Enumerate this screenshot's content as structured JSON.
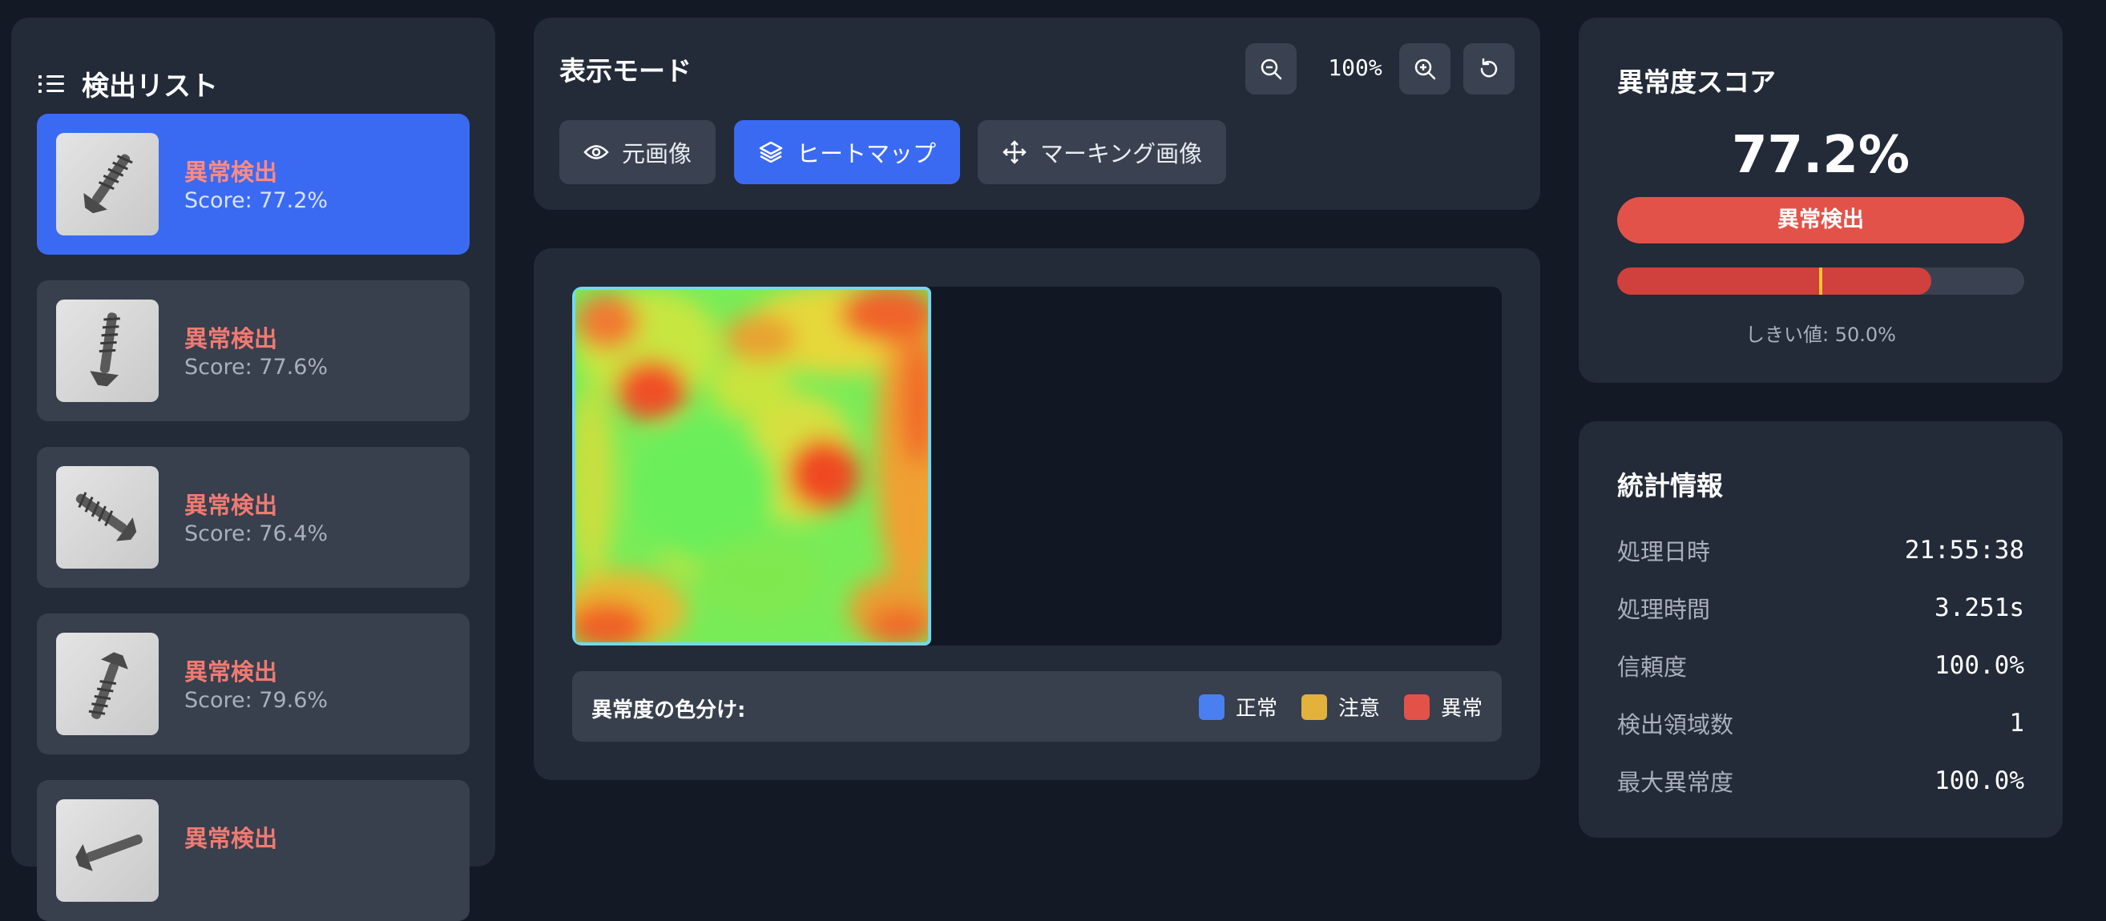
{
  "detection_list": {
    "title": "検出リスト",
    "items": [
      {
        "status": "異常検出",
        "score": "Score: 77.2%"
      },
      {
        "status": "異常検出",
        "score": "Score: 77.6%"
      },
      {
        "status": "異常検出",
        "score": "Score: 76.4%"
      },
      {
        "status": "異常検出",
        "score": "Score: 79.6%"
      },
      {
        "status": "異常検出",
        "score": ""
      }
    ]
  },
  "display_mode": {
    "title": "表示モード",
    "zoom": "100%",
    "buttons": {
      "original": "元画像",
      "heatmap": "ヒートマップ",
      "marking": "マーキング画像"
    },
    "active": "heatmap"
  },
  "legend": {
    "title": "異常度の色分け:",
    "normal": "正常",
    "caution": "注意",
    "anomaly": "異常",
    "colors": {
      "normal": "#4a7ff0",
      "caution": "#e3b23c",
      "anomaly": "#e25249"
    }
  },
  "anomaly_score": {
    "title": "異常度スコア",
    "value": "77.2%",
    "badge": "異常検出",
    "level": 0.772,
    "threshold_level": 0.5,
    "threshold": "しきい値: 50.0%"
  },
  "stats": {
    "title": "統計情報",
    "rows": [
      {
        "label": "処理日時",
        "value": "21:55:38"
      },
      {
        "label": "処理時間",
        "value": "3.251s"
      },
      {
        "label": "信頼度",
        "value": "100.0%"
      },
      {
        "label": "検出領域数",
        "value": "1"
      },
      {
        "label": "最大異常度",
        "value": "100.0%"
      }
    ]
  },
  "colors": {
    "accent": "#3b6af2",
    "anomaly": "#e25249",
    "background": "#131925",
    "panel": "#232a38"
  }
}
